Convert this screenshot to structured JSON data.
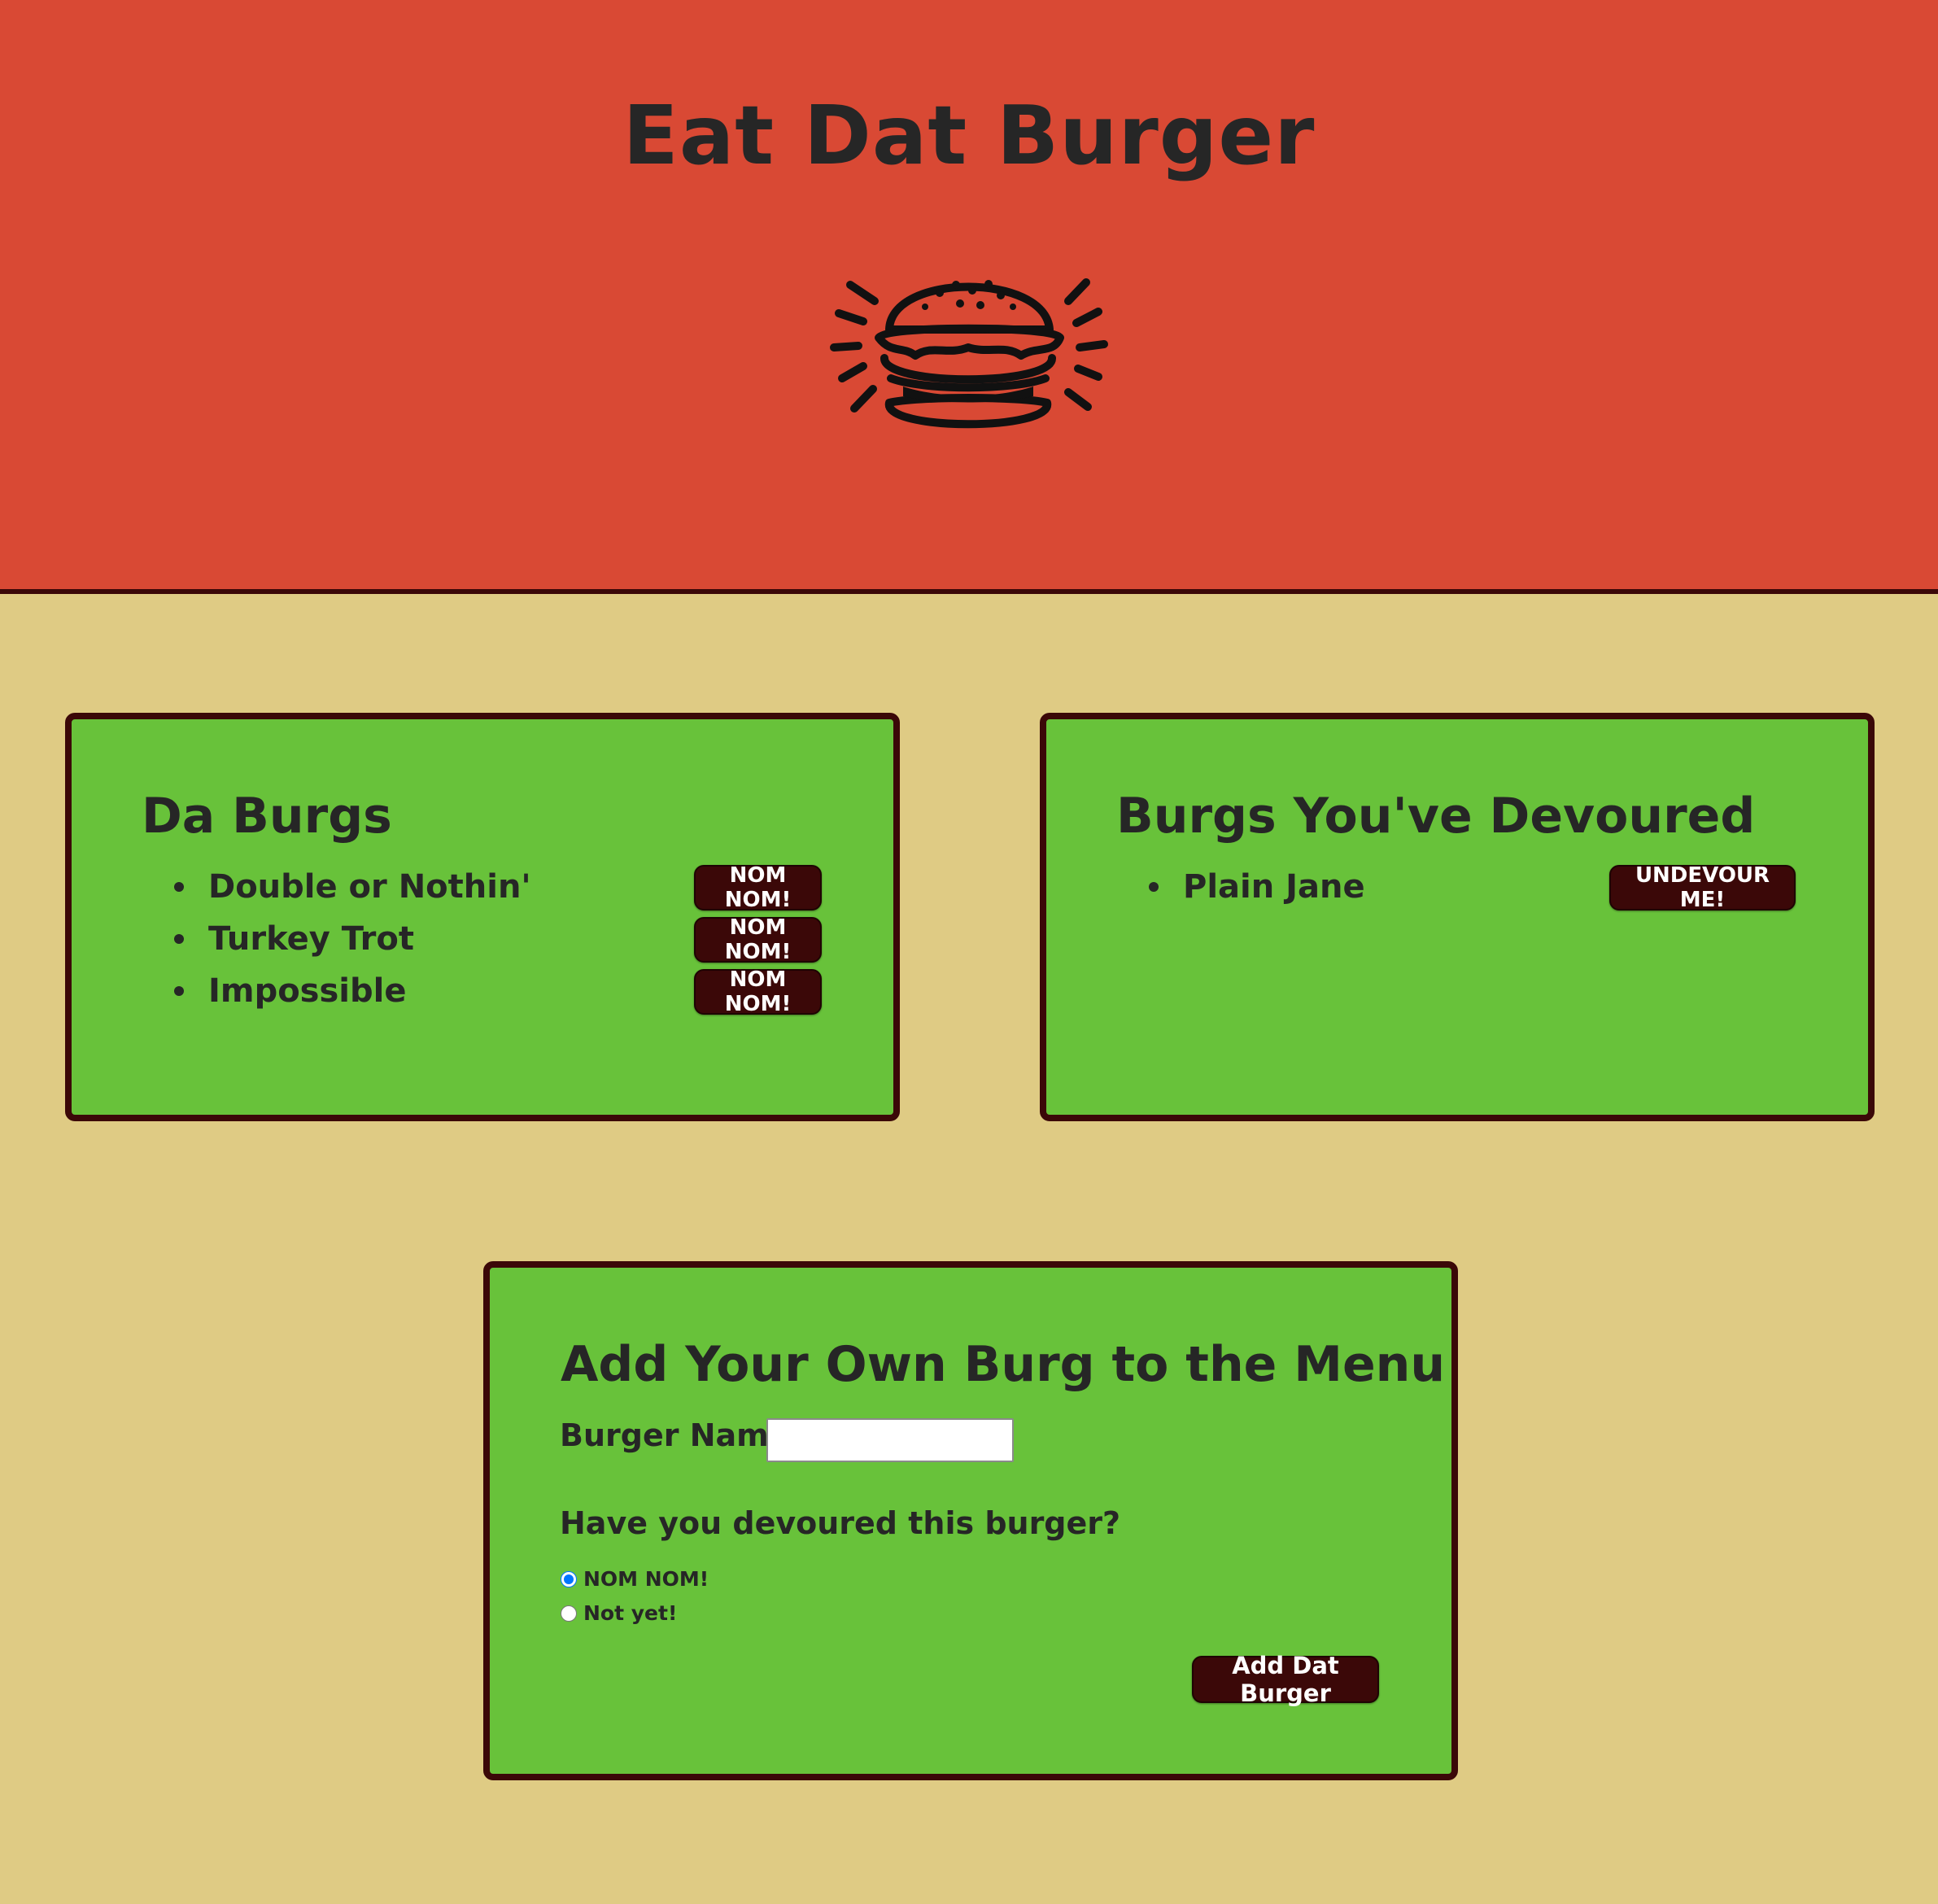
{
  "header": {
    "title": "Eat Dat Burger",
    "logo_icon": "burger-icon",
    "background": "#d94934"
  },
  "uneaten": {
    "title": "Da Burgs",
    "items": [
      {
        "name": "Double or Nothin'",
        "button": "NOM NOM!"
      },
      {
        "name": "Turkey Trot",
        "button": "NOM NOM!"
      },
      {
        "name": "Impossible",
        "button": "NOM NOM!"
      }
    ]
  },
  "devoured": {
    "title": "Burgs You've Devoured",
    "items": [
      {
        "name": "Plain Jane",
        "button": "UNDEVOUR ME!"
      }
    ]
  },
  "add_form": {
    "title": "Add Your Own Burg to the Menu",
    "name_label": "Burger Name:",
    "name_value": "",
    "question": "Have you devoured this burger?",
    "options": [
      {
        "label": "NOM NOM!",
        "checked": true
      },
      {
        "label": "Not yet!",
        "checked": false
      }
    ],
    "submit_label": "Add Dat Burger"
  },
  "colors": {
    "page_background": "#dfcb84",
    "card_background": "#68c23a",
    "button_background": "#3b0808",
    "text": "#262626"
  }
}
